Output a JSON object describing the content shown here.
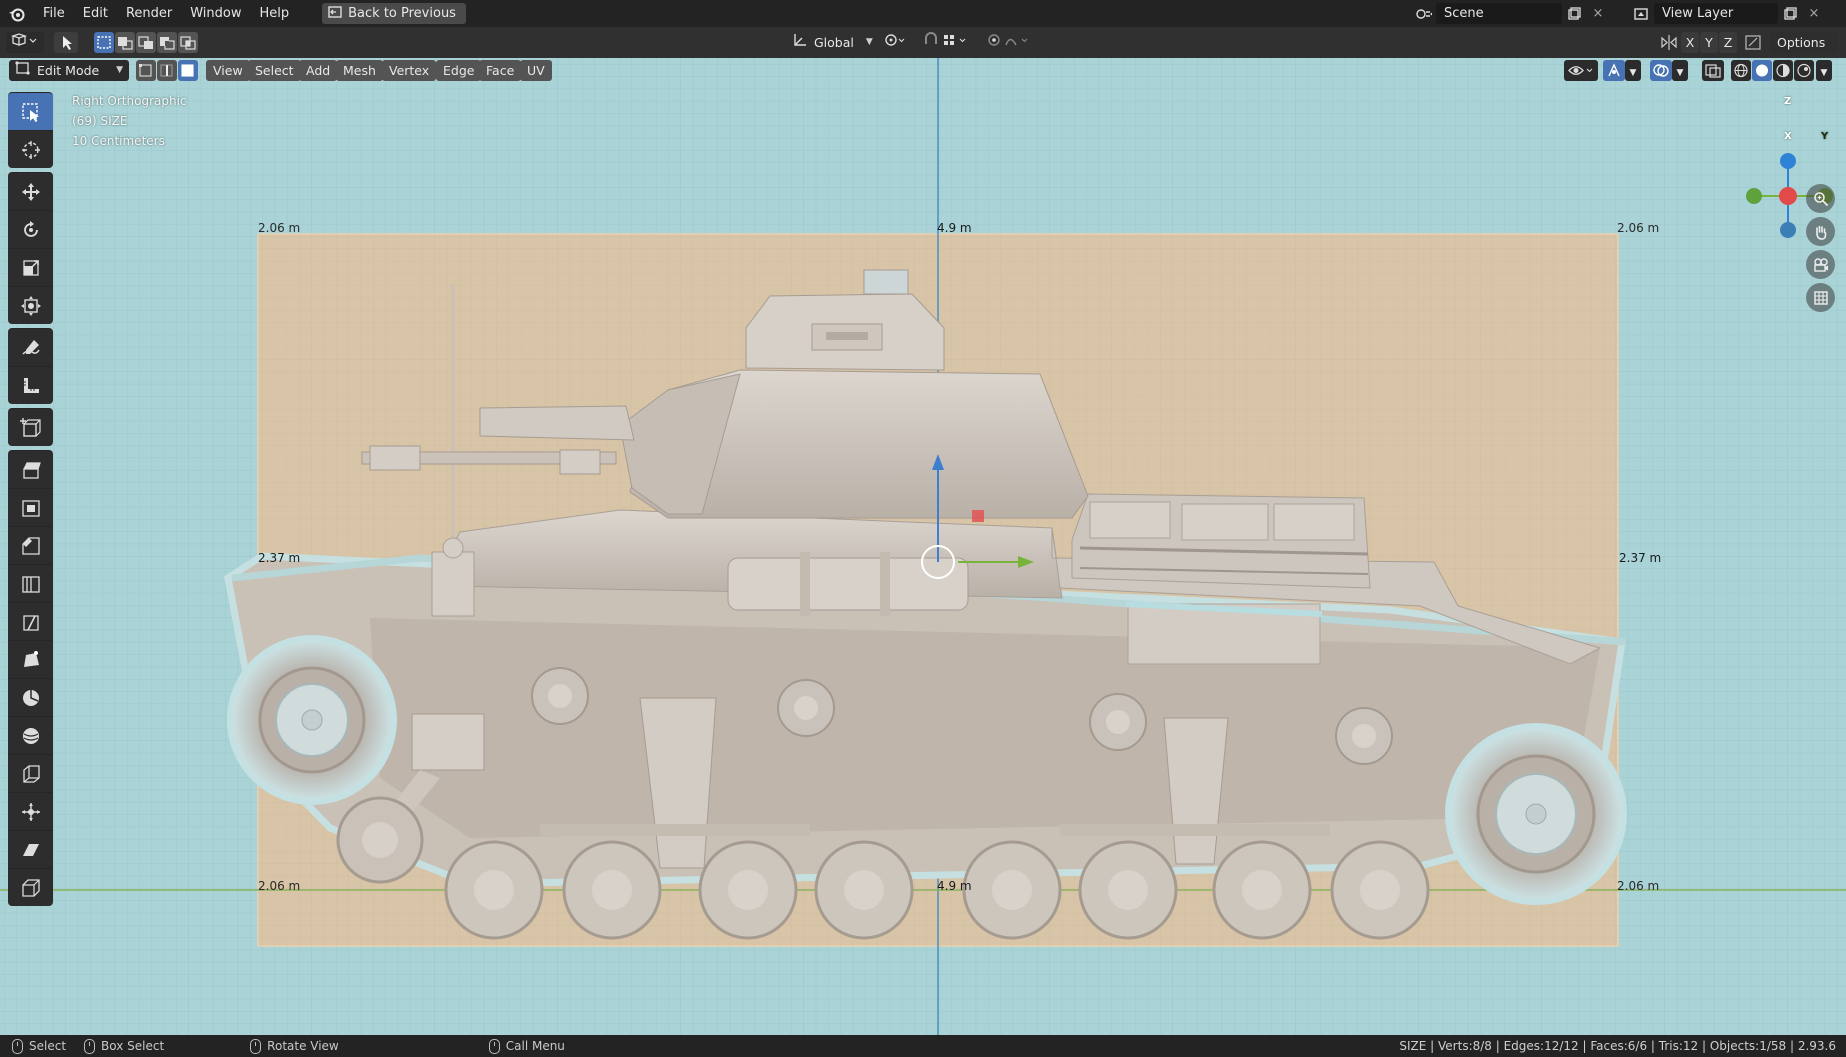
{
  "menu": {
    "items": [
      "File",
      "Edit",
      "Render",
      "Window",
      "Help"
    ],
    "back_button": "Back to Previous"
  },
  "scene": {
    "label": "Scene",
    "view_layer": "View Layer"
  },
  "tool_settings": {
    "orientation": "Global",
    "axes": [
      "X",
      "Y",
      "Z"
    ],
    "options": "Options"
  },
  "viewport_header": {
    "mode": "Edit Mode",
    "menus": [
      "View",
      "Select",
      "Add",
      "Mesh",
      "Vertex",
      "Edge",
      "Face",
      "UV"
    ]
  },
  "overlay": {
    "view_name": "Right Orthographic",
    "object_name": "(69) SIZE",
    "grid_scale": "10 Centimeters"
  },
  "dimensions": {
    "top_left": "2.06 m",
    "top_center": "4.9 m",
    "top_right": "2.06 m",
    "mid_left": "2.37 m",
    "mid_right": "2.37 m",
    "bottom_left": "2.06 m",
    "bottom_center": "4.9 m",
    "bottom_right": "2.06 m"
  },
  "gizmo": {
    "z": "Z",
    "x": "X",
    "y": "Y"
  },
  "status": {
    "select": "Select",
    "box_select": "Box Select",
    "rotate_view": "Rotate View",
    "call_menu": "Call Menu",
    "stats": "SIZE | Verts:8/8 | Edges:12/12 | Faces:6/6 | Tris:12 | Objects:1/58 | 2.93.6"
  },
  "colors": {
    "accent": "#4772b3",
    "viewport_bg": "#a9d3d6",
    "plane": "#d8c4a6",
    "axis_z": "#2f83d6",
    "axis_x": "#e34b4b",
    "axis_y": "#7ab33a"
  },
  "icons": [
    "blender-logo-icon",
    "back-icon",
    "scene-icon",
    "view-layer-icon",
    "transform-orientation-icon",
    "pivot-icon",
    "snap-icon",
    "proportional-icon",
    "select-box-icon",
    "cursor-icon",
    "move-icon",
    "rotate-icon",
    "scale-icon",
    "transform-icon",
    "annotate-icon",
    "measure-icon",
    "add-cube-icon",
    "extrude-icon",
    "inset-icon",
    "bevel-icon",
    "loop-cut-icon",
    "knife-icon",
    "poly-build-icon",
    "spin-icon",
    "smooth-icon",
    "edge-slide-icon",
    "shrink-fatten-icon",
    "shear-icon",
    "rip-icon",
    "zoom-icon",
    "hand-icon",
    "camera-icon",
    "grid-icon",
    "mouse-icon"
  ]
}
